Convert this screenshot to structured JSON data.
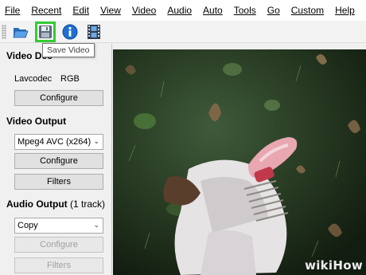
{
  "menu": [
    "File",
    "Recent",
    "Edit",
    "View",
    "Video",
    "Audio",
    "Auto",
    "Tools",
    "Go",
    "Custom",
    "Help"
  ],
  "toolbar": {
    "buttons": [
      {
        "icon": "open-folder-icon"
      },
      {
        "icon": "save-video-icon"
      },
      {
        "icon": "info-icon"
      },
      {
        "icon": "film-strip-icon"
      }
    ],
    "tooltip": "Save Video",
    "highlight_color": "#33cc33"
  },
  "video_decoder": {
    "title": "Video Dec",
    "codec": "Lavcodec",
    "format": "RGB",
    "configure": "Configure"
  },
  "video_output": {
    "title": "Video Output",
    "selected": "Mpeg4 AVC (x264)",
    "configure": "Configure",
    "filters": "Filters"
  },
  "audio_output": {
    "title": "Audio Output",
    "track_count": "(1 track)",
    "selected": "Copy",
    "configure": "Configure",
    "filters": "Filters"
  },
  "watermark": "wikiHow"
}
